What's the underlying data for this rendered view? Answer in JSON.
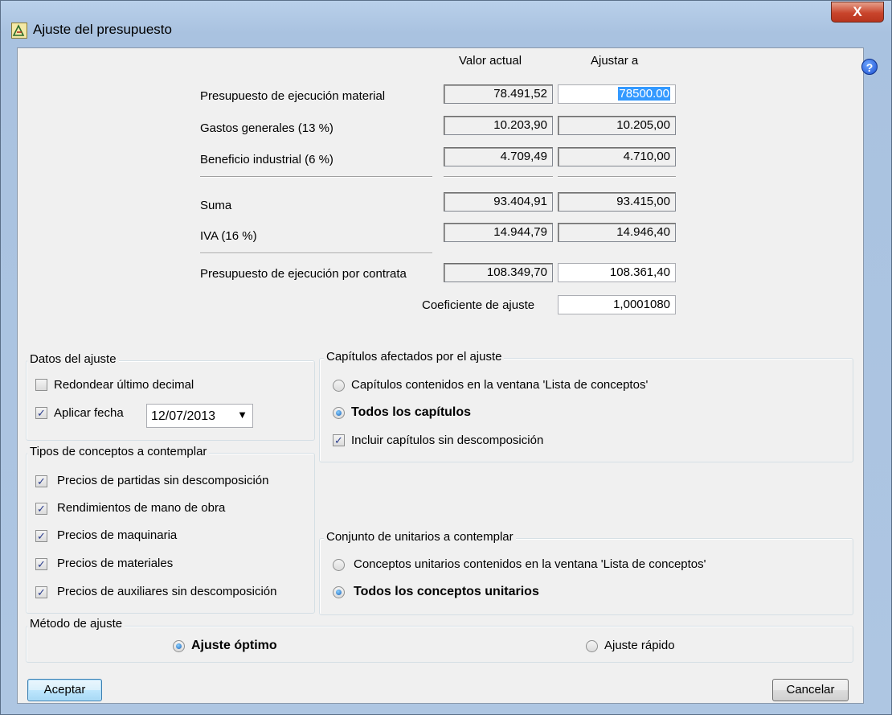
{
  "window": {
    "title": "Ajuste del presupuesto",
    "close_label": "X",
    "help_label": "?"
  },
  "columns": {
    "current": "Valor actual",
    "adjust": "Ajustar a"
  },
  "rows": [
    {
      "label": "Presupuesto de ejecución material",
      "current": "78.491,52",
      "adjust": "78500.00"
    },
    {
      "label": "Gastos generales (13 %)",
      "current": "10.203,90",
      "adjust": "10.205,00"
    },
    {
      "label": "Beneficio industrial (6 %)",
      "current": "4.709,49",
      "adjust": "4.710,00"
    },
    {
      "label": "Suma",
      "current": "93.404,91",
      "adjust": "93.415,00"
    },
    {
      "label": "IVA (16 %)",
      "current": "14.944,79",
      "adjust": "14.946,40"
    },
    {
      "label": "Presupuesto de ejecución por contrata",
      "current": "108.349,70",
      "adjust": "108.361,40"
    }
  ],
  "coefficient": {
    "label": "Coeficiente de ajuste",
    "value": "1,0001080"
  },
  "datos_ajuste": {
    "title": "Datos del ajuste",
    "round_label": "Redondear último decimal",
    "round_checked": false,
    "date_label": "Aplicar fecha",
    "date_checked": true,
    "date_value": "12/07/2013"
  },
  "tipos_conceptos": {
    "title": "Tipos de conceptos a contemplar",
    "items": [
      {
        "label": "Precios de partidas sin descomposición",
        "checked": true
      },
      {
        "label": "Rendimientos de mano de obra",
        "checked": true
      },
      {
        "label": "Precios de maquinaria",
        "checked": true
      },
      {
        "label": "Precios de materiales",
        "checked": true
      },
      {
        "label": "Precios de auxiliares sin descomposición",
        "checked": true
      }
    ]
  },
  "capitulos": {
    "title": "Capítulos afectados por el ajuste",
    "option_window": "Capítulos contenidos en la ventana 'Lista de conceptos'",
    "option_all": "Todos los capítulos",
    "selected": "all",
    "include_label": "Incluir capítulos sin descomposición",
    "include_checked": true
  },
  "unitarios": {
    "title": "Conjunto de unitarios a contemplar",
    "option_window": "Conceptos unitarios contenidos en la ventana 'Lista de conceptos'",
    "option_all": "Todos los conceptos unitarios",
    "selected": "all"
  },
  "metodo": {
    "title": "Método de ajuste",
    "option_optimo": "Ajuste óptimo",
    "option_rapido": "Ajuste rápido",
    "selected": "optimo"
  },
  "buttons": {
    "accept": "Aceptar",
    "cancel": "Cancelar"
  },
  "icons": {
    "app": "budget-adjust-icon",
    "help": "help-icon",
    "close": "close-icon",
    "dropdown": "chevron-down-icon"
  }
}
